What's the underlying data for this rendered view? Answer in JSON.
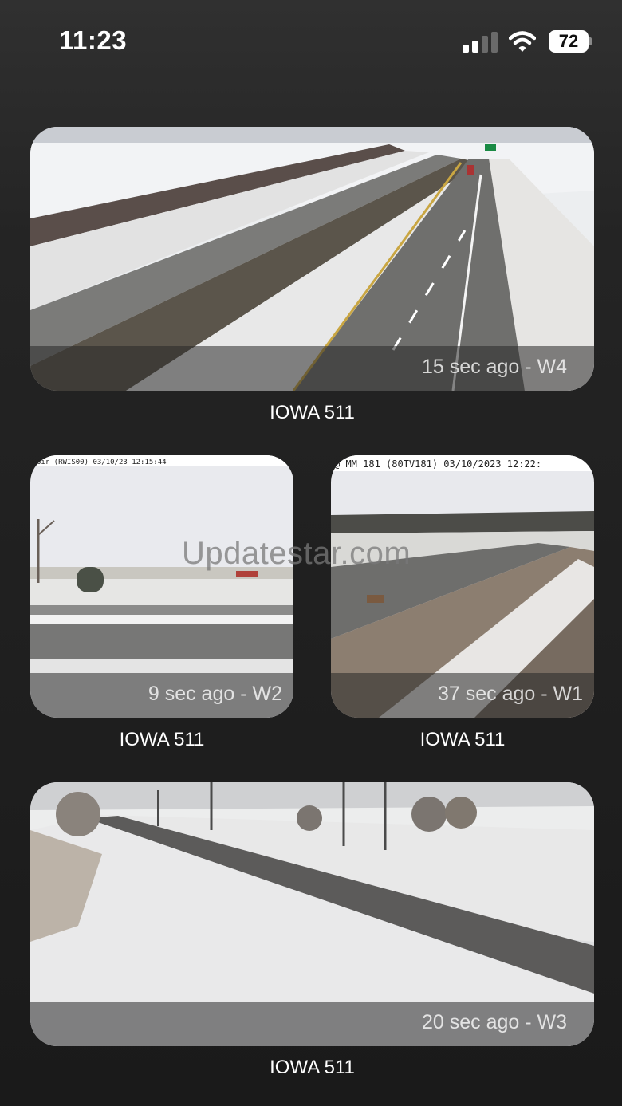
{
  "status_bar": {
    "time": "11:23",
    "battery": "72"
  },
  "cameras": [
    {
      "label": "IOWA 511",
      "ago": "15 sec ago - W4"
    },
    {
      "label": "IOWA 511",
      "ago": "9 sec ago - W2",
      "stamp": "3ir (RWIS00)   03/10/23  12:15:44"
    },
    {
      "label": "IOWA 511",
      "ago": "37 sec ago - W1",
      "stamp": "@ MM 181 (80TV181) 03/10/2023 12:22:"
    },
    {
      "label": "IOWA 511",
      "ago": "20 sec ago - W3"
    }
  ],
  "watermark": "Updatestar.com"
}
